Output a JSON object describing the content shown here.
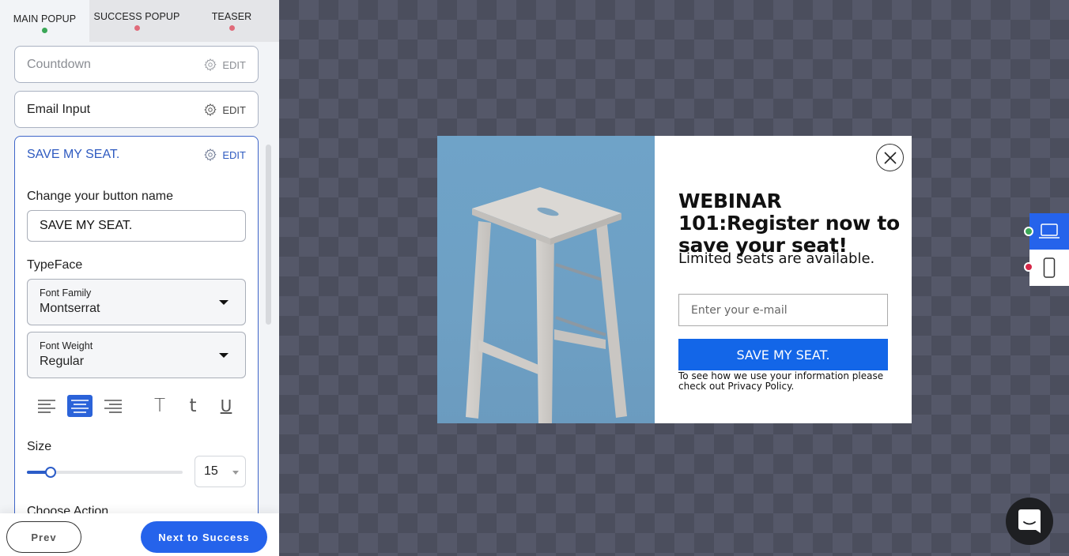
{
  "tabs": [
    {
      "label": "MAIN POPUP",
      "status_color": "#3aa757"
    },
    {
      "label": "SUCCESS POPUP",
      "status_color": "#e06b7a"
    },
    {
      "label": "TEASER",
      "status_color": "#e06b7a"
    }
  ],
  "elements": [
    {
      "title": "Countdown",
      "edit_label": "EDIT"
    },
    {
      "title": "Email Input",
      "edit_label": "EDIT"
    },
    {
      "title": "SAVE MY SEAT.",
      "edit_label": "EDIT"
    }
  ],
  "button_editor": {
    "name_label": "Change your button name",
    "name_value": "SAVE MY SEAT.",
    "typeface_label": "TypeFace",
    "font_family": {
      "label": "Font Family",
      "value": "Montserrat"
    },
    "font_weight": {
      "label": "Font Weight",
      "value": "Regular"
    },
    "alignment": {
      "options": [
        "left",
        "center",
        "right"
      ],
      "selected": "center"
    },
    "text_transform": {
      "uppercase": "T",
      "lowercase": "t",
      "underline": "U"
    },
    "size_label": "Size",
    "size_value": "15",
    "size_slider_fraction": 0.15,
    "next_section_label": "Choose Action"
  },
  "footer": {
    "prev_label": "Prev",
    "next_label": "Next to Success"
  },
  "popup": {
    "headline": "WEBINAR 101:Register now to save your seat!",
    "subtext": "Limited seats are available.",
    "email_placeholder": "Enter your e-mail",
    "cta_label": "SAVE MY SEAT.",
    "privacy_text": "To see how we use your information please check out Privacy Policy.",
    "image_alt": "wooden bar stool on blue background"
  },
  "devices": [
    {
      "name": "desktop",
      "status_color": "#3aa757",
      "active": true
    },
    {
      "name": "mobile",
      "status_color": "#d62748",
      "active": false
    }
  ],
  "colors": {
    "accent": "#2563eb",
    "cta": "#1366e8"
  }
}
